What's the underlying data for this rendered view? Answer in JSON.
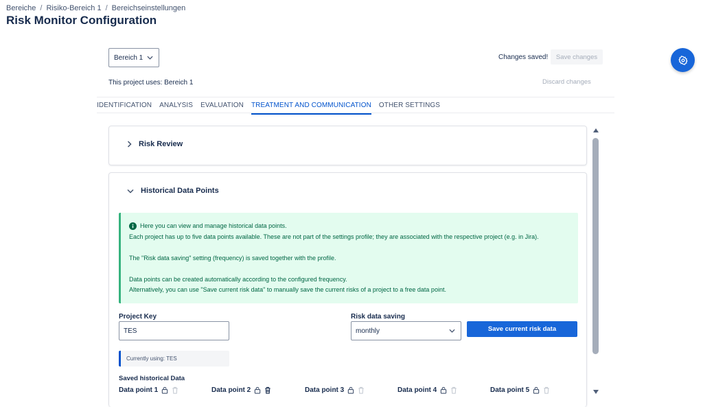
{
  "breadcrumb": [
    "Bereiche",
    "Risiko-Bereich 1",
    "Bereichseinstellungen"
  ],
  "page_title": "Risk Monitor Configuration",
  "toolbar": {
    "area_select": "Bereich 1",
    "changes_saved": "Changes saved!",
    "save_changes": "Save changes",
    "project_uses": "This project uses: Bereich 1",
    "discard_changes": "Discard changes"
  },
  "tabs": [
    {
      "label": "IDENTIFICATION",
      "active": false
    },
    {
      "label": "ANALYSIS",
      "active": false
    },
    {
      "label": "EVALUATION",
      "active": false
    },
    {
      "label": "TREATMENT AND COMMUNICATION",
      "active": true
    },
    {
      "label": "OTHER SETTINGS",
      "active": false
    }
  ],
  "panels": {
    "risk_review": {
      "title": "Risk Review",
      "expanded": false
    },
    "historical": {
      "title": "Historical Data Points",
      "expanded": true
    }
  },
  "info": {
    "line1": "Here you can view and manage historical data points.",
    "line2": "Each project has up to five data points available. These are not part of the settings profile; they are associated with the respective project (e.g. in Jira).",
    "line3": "The \"Risk data saving\" setting (frequency) is saved together with the profile.",
    "line4": "Data points can be created automatically according to the configured frequency.",
    "line5": "Alternatively, you can use \"Save current risk data\" to manually save the current risks of a project to a free data point."
  },
  "form": {
    "project_key_label": "Project Key",
    "project_key_value": "TES",
    "risk_saving_label": "Risk data saving",
    "risk_saving_value": "monthly",
    "save_current_btn": "Save current risk data",
    "currently_using": "Currently using: TES"
  },
  "saved": {
    "title": "Saved historical Data",
    "data_points": [
      {
        "label": "Data point 1",
        "has_data": false
      },
      {
        "label": "Data point 2",
        "has_data": true
      },
      {
        "label": "Data point 3",
        "has_data": false
      },
      {
        "label": "Data point 4",
        "has_data": false
      },
      {
        "label": "Data point 5",
        "has_data": false
      }
    ]
  },
  "colors": {
    "primary": "#1866d9",
    "tab_active": "#0052cc",
    "info_bg": "#e3fcef",
    "info_text": "#006644"
  }
}
